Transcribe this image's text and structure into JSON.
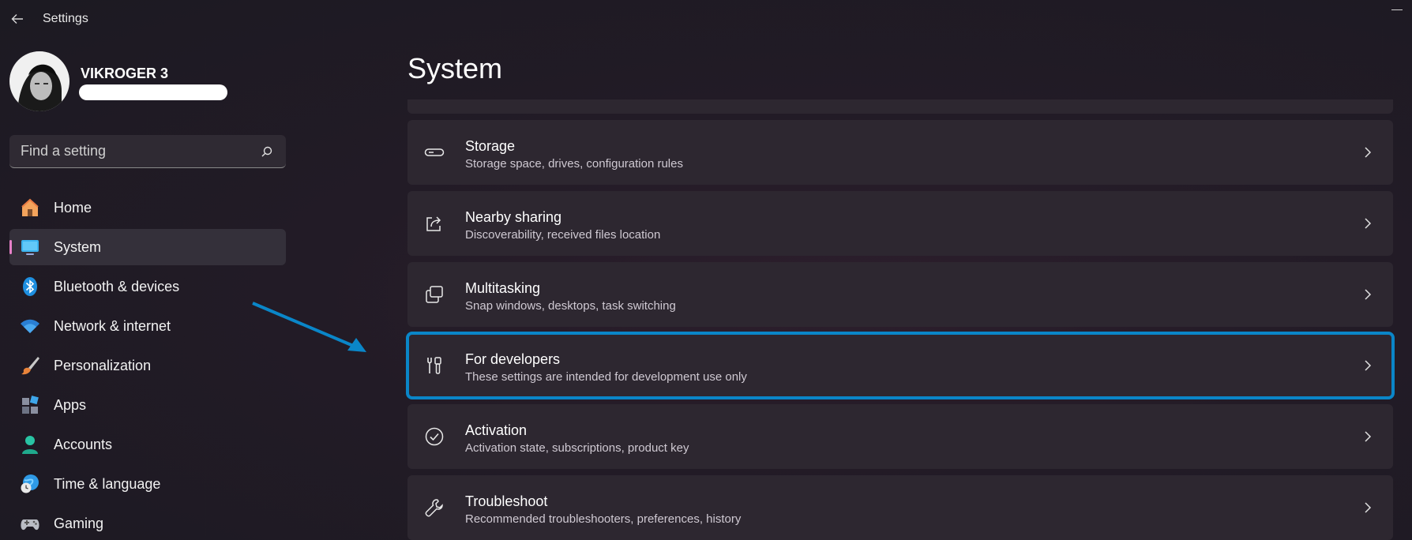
{
  "window": {
    "title": "Settings"
  },
  "profile": {
    "name": "VIKROGER 3"
  },
  "search": {
    "placeholder": "Find a setting"
  },
  "sidebar": {
    "items": [
      {
        "label": "Home",
        "icon": "home-icon"
      },
      {
        "label": "System",
        "icon": "system-icon",
        "selected": true
      },
      {
        "label": "Bluetooth & devices",
        "icon": "bluetooth-icon"
      },
      {
        "label": "Network & internet",
        "icon": "wifi-icon"
      },
      {
        "label": "Personalization",
        "icon": "brush-icon"
      },
      {
        "label": "Apps",
        "icon": "apps-icon"
      },
      {
        "label": "Accounts",
        "icon": "accounts-icon"
      },
      {
        "label": "Time & language",
        "icon": "globe-clock-icon"
      },
      {
        "label": "Gaming",
        "icon": "gamepad-icon"
      }
    ]
  },
  "main": {
    "title": "System",
    "cards": [
      {
        "title": "Storage",
        "subtitle": "Storage space, drives, configuration rules",
        "icon": "storage-icon"
      },
      {
        "title": "Nearby sharing",
        "subtitle": "Discoverability, received files location",
        "icon": "share-icon"
      },
      {
        "title": "Multitasking",
        "subtitle": "Snap windows, desktops, task switching",
        "icon": "multitasking-icon"
      },
      {
        "title": "For developers",
        "subtitle": "These settings are intended for development use only",
        "icon": "developer-tools-icon",
        "highlighted": true
      },
      {
        "title": "Activation",
        "subtitle": "Activation state, subscriptions, product key",
        "icon": "check-circle-icon"
      },
      {
        "title": "Troubleshoot",
        "subtitle": "Recommended troubleshooters, preferences, history",
        "icon": "wrench-icon"
      }
    ]
  },
  "colors": {
    "accent": "#e680c8",
    "highlight": "#0a86c8",
    "card": "#2d2730"
  }
}
